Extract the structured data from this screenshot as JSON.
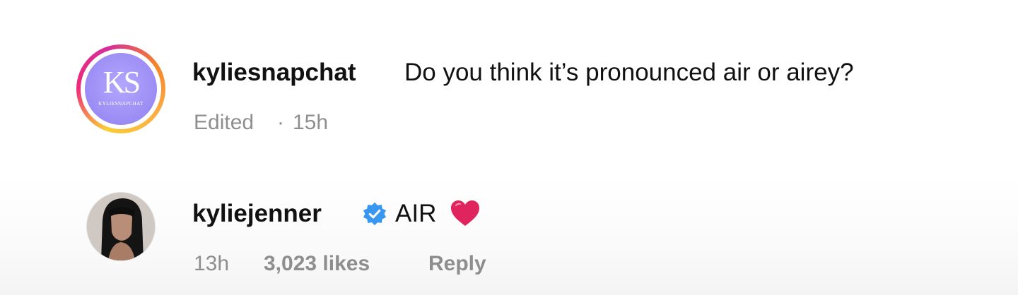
{
  "comments": [
    {
      "username": "kyliesnapchat",
      "text": "Do you think it’s pronounced air or airey?",
      "edited": "Edited",
      "separator": "·",
      "time": "15h",
      "avatar": {
        "monogram": "KS",
        "subtext": "KYLIESNAPCHAT",
        "icon": "ks-logo-avatar",
        "badge_color": "#9d8ff5"
      }
    },
    {
      "username": "kyliejenner",
      "verified": true,
      "verified_icon": "verified-badge-icon",
      "text": "AIR",
      "emoji": "heart-icon",
      "time": "13h",
      "likes": "3,023 likes",
      "reply": "Reply",
      "avatar": {
        "icon": "profile-photo"
      }
    }
  ],
  "colors": {
    "text": "#111111",
    "muted": "#8e8e8e",
    "verified": "#3897f0",
    "heart": "#e0245e"
  }
}
